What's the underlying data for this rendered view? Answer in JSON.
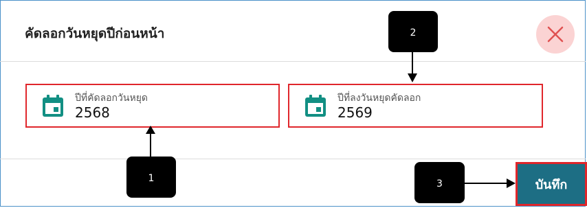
{
  "dialog": {
    "title": "คัดลอกวันหยุดปีก่อนหน้า"
  },
  "fields": [
    {
      "label": "ปีที่คัดลอกวันหยุด",
      "value": "2568",
      "icon": "calendar-icon"
    },
    {
      "label": "ปีที่ลงวันหยุดคัดลอก",
      "value": "2569",
      "icon": "calendar-icon"
    }
  ],
  "footer": {
    "save_label": "บันทึก"
  },
  "annotations": [
    "1",
    "2",
    "3"
  ],
  "colors": {
    "accent": "#1d6e84",
    "calendar_icon": "#128f83",
    "highlight_border": "#e0262b",
    "close_bg": "#fbd3d3",
    "close_x": "#e05151"
  }
}
